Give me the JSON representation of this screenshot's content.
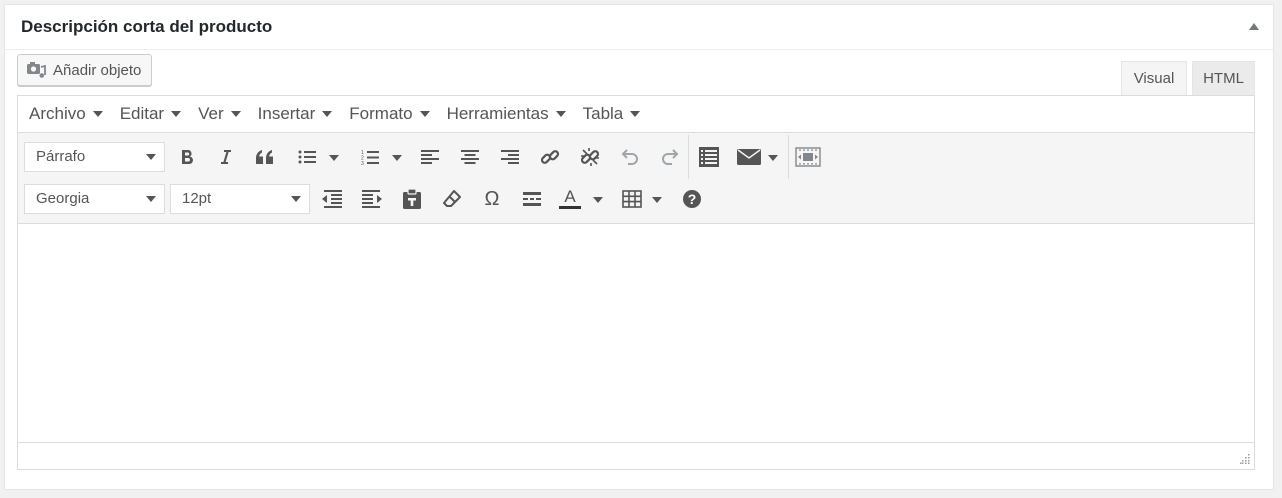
{
  "postbox": {
    "title": "Descripción corta del producto",
    "toggle_icon": "arrow-up-icon"
  },
  "media_button": {
    "label": "Añadir objeto",
    "icon": "camera-music-icon"
  },
  "tabs": {
    "visual": "Visual",
    "html": "HTML"
  },
  "menubar": [
    "Archivo",
    "Editar",
    "Ver",
    "Insertar",
    "Formato",
    "Herramientas",
    "Tabla"
  ],
  "toolbar": {
    "format_select": "Párrafo",
    "font_select": "Georgia",
    "size_select": "12pt"
  },
  "colors": {
    "icon": "#555555",
    "icon_disabled": "#a0a5aa",
    "toolbar_bg": "#f5f5f5",
    "border": "#dcdcdc"
  }
}
